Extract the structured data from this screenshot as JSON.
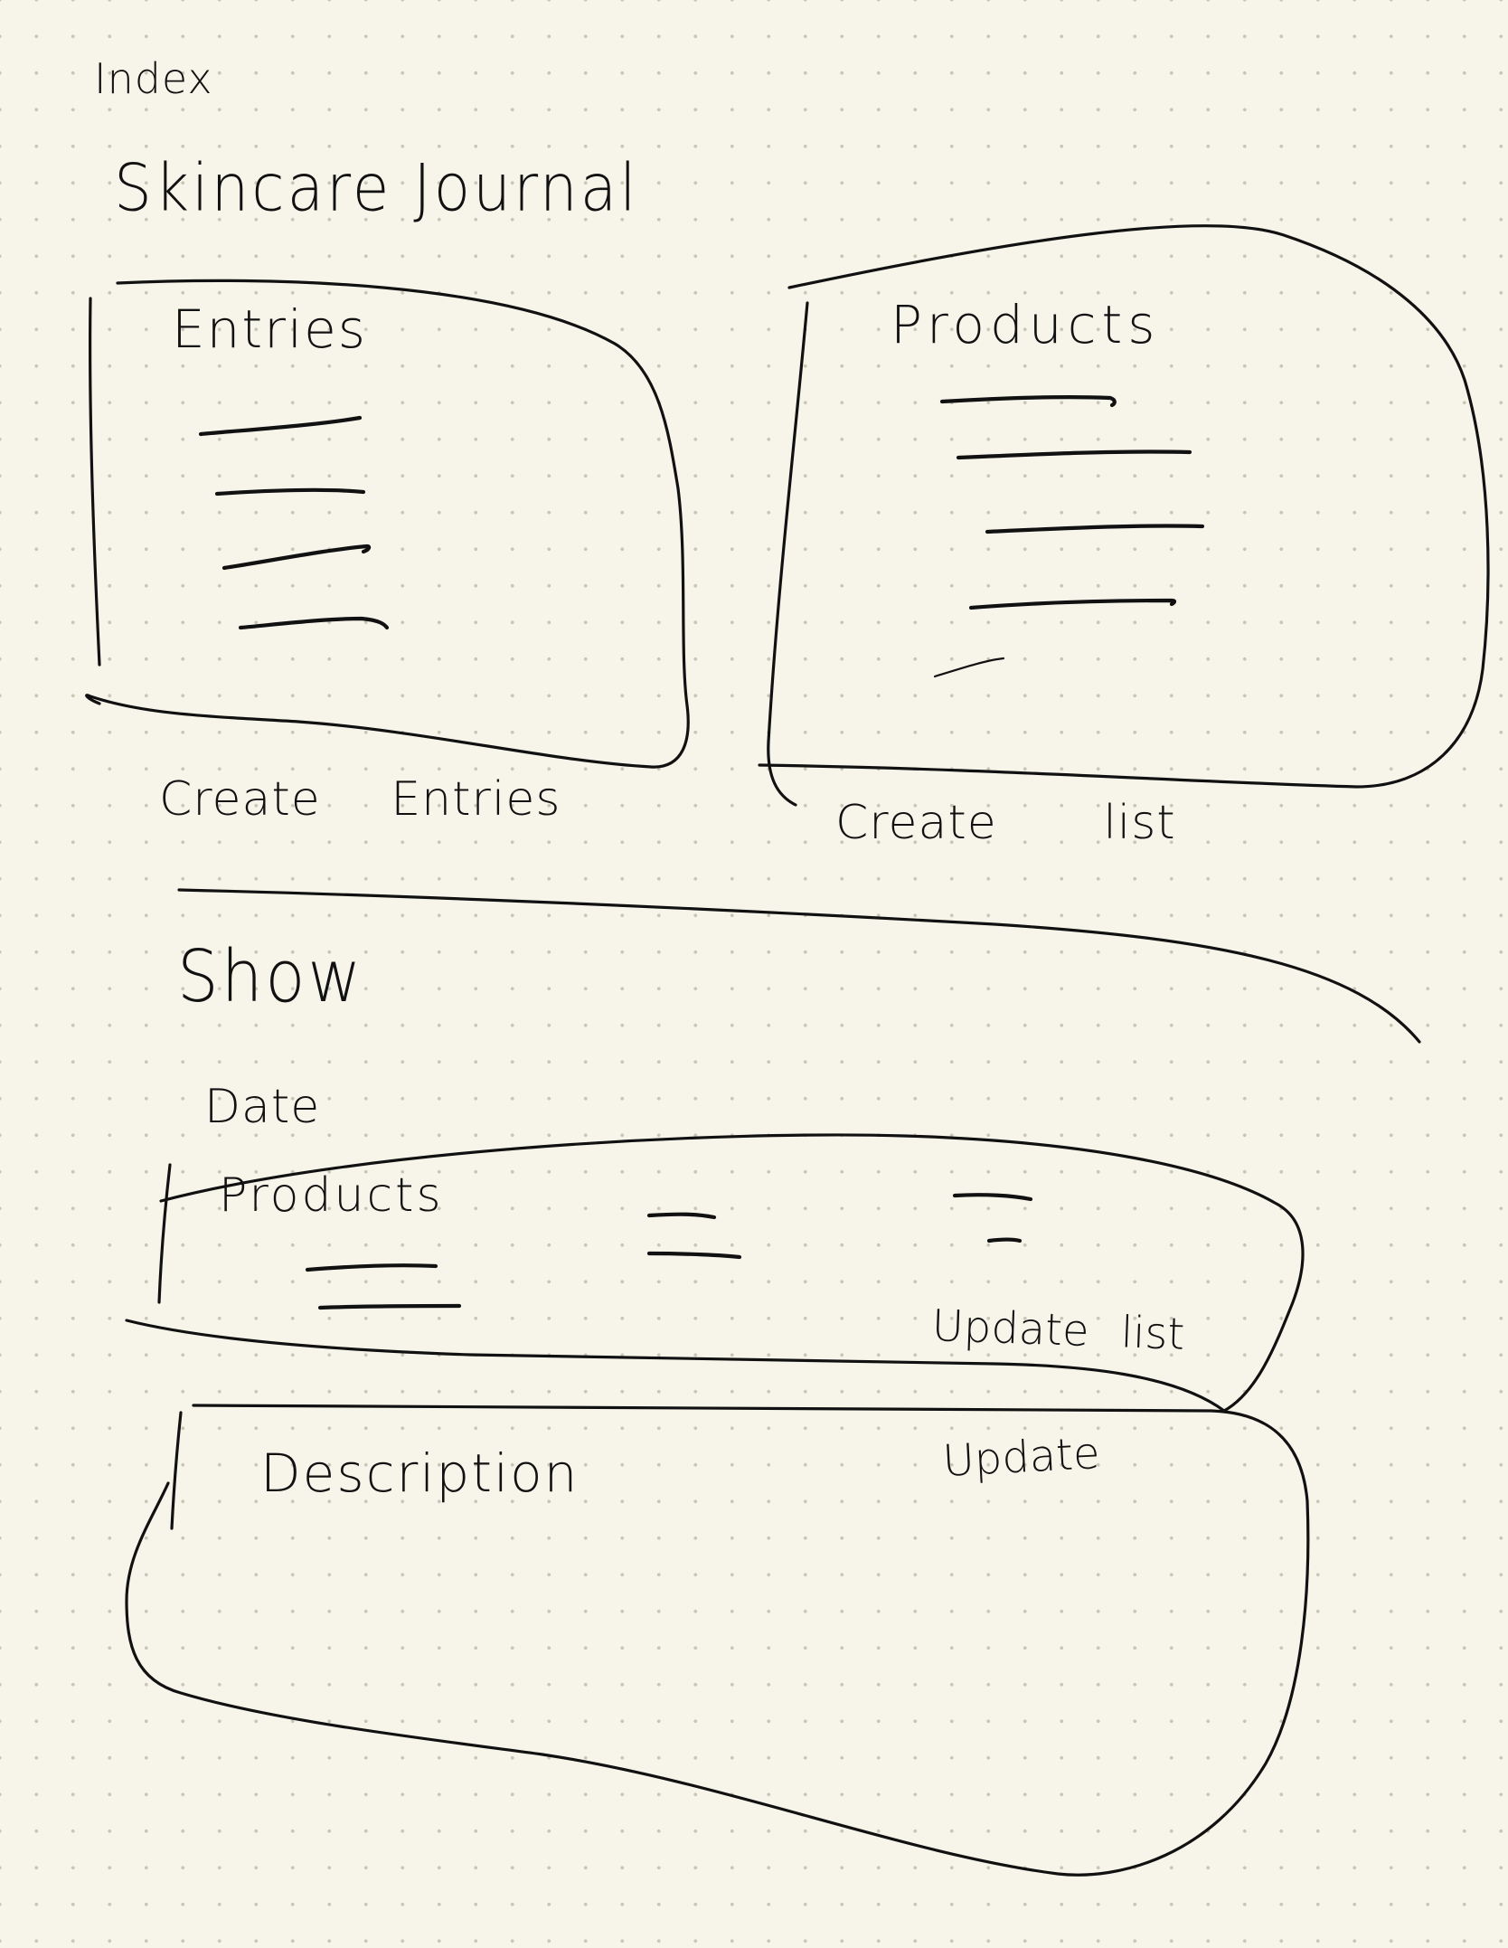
{
  "page_label": "Index",
  "app_title": "Skincare Journal",
  "index": {
    "entries_panel": {
      "heading": "Entries",
      "placeholder_line_count": 4
    },
    "products_panel": {
      "heading": "Products",
      "placeholder_line_count": 5
    },
    "create_entries_label": "Create Entries",
    "create_list_label": "Create list"
  },
  "show": {
    "section_label": "Show",
    "date_label": "Date",
    "products_panel": {
      "heading": "Products",
      "update_list_label": "Update list"
    },
    "description_panel": {
      "heading": "Description",
      "update_label": "Update"
    }
  },
  "colors": {
    "paper": "#f7f5ea",
    "dot_grid": "#c9c6b8",
    "ink": "#111111"
  }
}
